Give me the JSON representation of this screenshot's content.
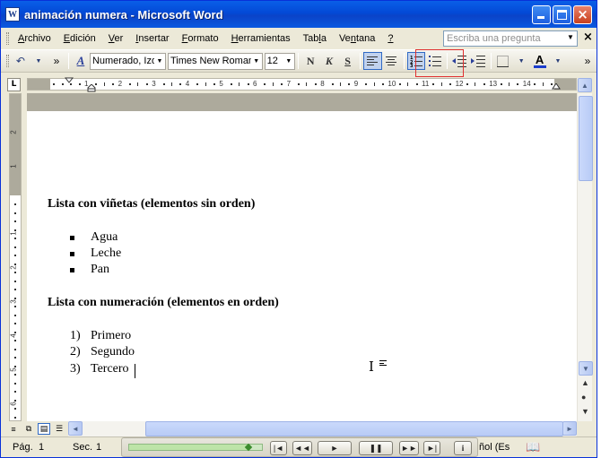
{
  "window": {
    "title": "animación numera - Microsoft Word",
    "app_icon_glyph": "W",
    "buttons": {
      "minimize": "minimize",
      "maximize": "maximize",
      "close": "×"
    }
  },
  "menubar": {
    "items": [
      {
        "label": "Archivo",
        "mnemonic_index": 0
      },
      {
        "label": "Edición",
        "mnemonic_index": 0
      },
      {
        "label": "Ver",
        "mnemonic_index": 0
      },
      {
        "label": "Insertar",
        "mnemonic_index": 0
      },
      {
        "label": "Formato",
        "mnemonic_index": 0
      },
      {
        "label": "Herramientas",
        "mnemonic_index": 0
      },
      {
        "label": "Tabla",
        "mnemonic_index": 3
      },
      {
        "label": "Ventana",
        "mnemonic_index": 2
      },
      {
        "label": "?",
        "mnemonic_index": 0
      }
    ],
    "ask_placeholder": "Escriba una pregunta",
    "doc_close": "×"
  },
  "toolbar": {
    "undo_glyph": "↶",
    "more_glyph": "»",
    "style_icon": "A",
    "style_value": "Numerado, Izqu",
    "font_value": "Times New Roman",
    "size_value": "12",
    "bold_label": "N",
    "italic_label": "K",
    "underline_label": "S",
    "color_label": "A",
    "accent_color": "#e03030",
    "font_color": "#1a3ccc"
  },
  "ruler": {
    "tab_selector": "L",
    "h_numbers": [
      "1",
      "2",
      "3",
      "4",
      "5",
      "6",
      "7",
      "8",
      "9",
      "10",
      "11",
      "12",
      "13",
      "14"
    ],
    "v_numbers_top": [
      "2",
      "1"
    ],
    "v_numbers": [
      "1",
      "2",
      "3",
      "4",
      "5",
      "6"
    ]
  },
  "document": {
    "heading1": "Lista con viñetas (elementos sin orden)",
    "bullets": [
      "Agua",
      "Leche",
      "Pan"
    ],
    "heading2": "Lista con numeración (elementos en orden)",
    "numbered": [
      {
        "num": "1)",
        "text": "Primero"
      },
      {
        "num": "2)",
        "text": "Segundo"
      },
      {
        "num": "3)",
        "text": "Tercero"
      }
    ],
    "ibeam": "I"
  },
  "scroll": {
    "up": "▲",
    "down": "▼",
    "left": "◄",
    "right": "►",
    "prev_page": "▲",
    "select_browse": "●",
    "next_page": "▼"
  },
  "statusbar": {
    "page": "Pág.",
    "page_num": "1",
    "section": "Sec.",
    "section_num": "1",
    "language": "ñol (Es",
    "player_progress": 0.9
  }
}
